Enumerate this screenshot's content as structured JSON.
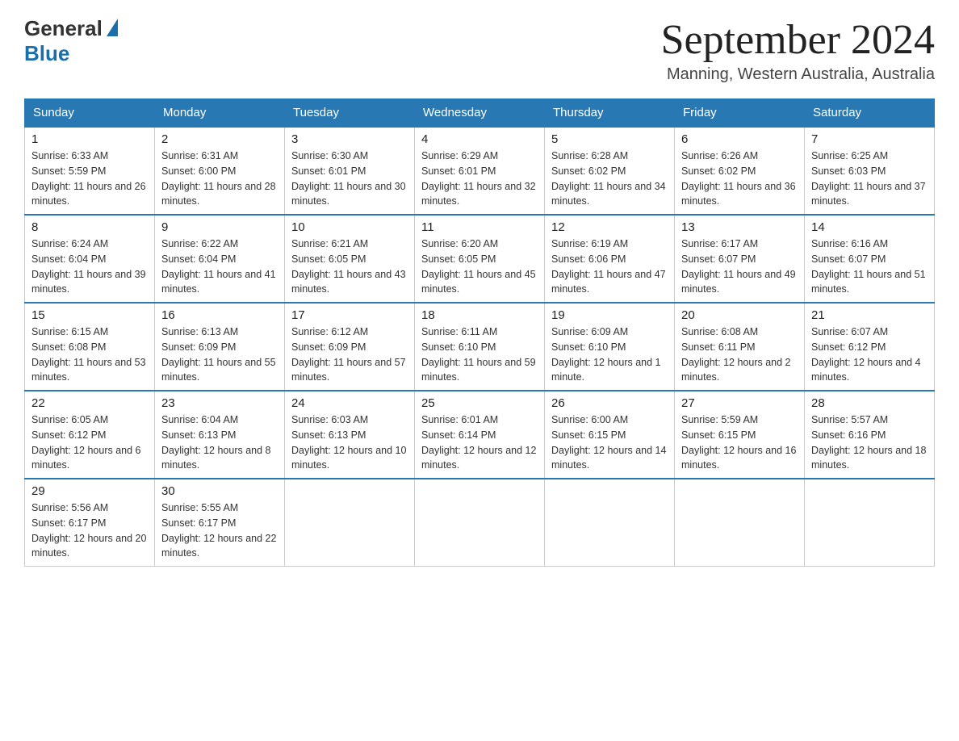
{
  "header": {
    "logo_general": "General",
    "logo_blue": "Blue",
    "month_title": "September 2024",
    "location": "Manning, Western Australia, Australia"
  },
  "weekdays": [
    "Sunday",
    "Monday",
    "Tuesday",
    "Wednesday",
    "Thursday",
    "Friday",
    "Saturday"
  ],
  "weeks": [
    [
      {
        "day": "1",
        "sunrise": "6:33 AM",
        "sunset": "5:59 PM",
        "daylight": "11 hours and 26 minutes."
      },
      {
        "day": "2",
        "sunrise": "6:31 AM",
        "sunset": "6:00 PM",
        "daylight": "11 hours and 28 minutes."
      },
      {
        "day": "3",
        "sunrise": "6:30 AM",
        "sunset": "6:01 PM",
        "daylight": "11 hours and 30 minutes."
      },
      {
        "day": "4",
        "sunrise": "6:29 AM",
        "sunset": "6:01 PM",
        "daylight": "11 hours and 32 minutes."
      },
      {
        "day": "5",
        "sunrise": "6:28 AM",
        "sunset": "6:02 PM",
        "daylight": "11 hours and 34 minutes."
      },
      {
        "day": "6",
        "sunrise": "6:26 AM",
        "sunset": "6:02 PM",
        "daylight": "11 hours and 36 minutes."
      },
      {
        "day": "7",
        "sunrise": "6:25 AM",
        "sunset": "6:03 PM",
        "daylight": "11 hours and 37 minutes."
      }
    ],
    [
      {
        "day": "8",
        "sunrise": "6:24 AM",
        "sunset": "6:04 PM",
        "daylight": "11 hours and 39 minutes."
      },
      {
        "day": "9",
        "sunrise": "6:22 AM",
        "sunset": "6:04 PM",
        "daylight": "11 hours and 41 minutes."
      },
      {
        "day": "10",
        "sunrise": "6:21 AM",
        "sunset": "6:05 PM",
        "daylight": "11 hours and 43 minutes."
      },
      {
        "day": "11",
        "sunrise": "6:20 AM",
        "sunset": "6:05 PM",
        "daylight": "11 hours and 45 minutes."
      },
      {
        "day": "12",
        "sunrise": "6:19 AM",
        "sunset": "6:06 PM",
        "daylight": "11 hours and 47 minutes."
      },
      {
        "day": "13",
        "sunrise": "6:17 AM",
        "sunset": "6:07 PM",
        "daylight": "11 hours and 49 minutes."
      },
      {
        "day": "14",
        "sunrise": "6:16 AM",
        "sunset": "6:07 PM",
        "daylight": "11 hours and 51 minutes."
      }
    ],
    [
      {
        "day": "15",
        "sunrise": "6:15 AM",
        "sunset": "6:08 PM",
        "daylight": "11 hours and 53 minutes."
      },
      {
        "day": "16",
        "sunrise": "6:13 AM",
        "sunset": "6:09 PM",
        "daylight": "11 hours and 55 minutes."
      },
      {
        "day": "17",
        "sunrise": "6:12 AM",
        "sunset": "6:09 PM",
        "daylight": "11 hours and 57 minutes."
      },
      {
        "day": "18",
        "sunrise": "6:11 AM",
        "sunset": "6:10 PM",
        "daylight": "11 hours and 59 minutes."
      },
      {
        "day": "19",
        "sunrise": "6:09 AM",
        "sunset": "6:10 PM",
        "daylight": "12 hours and 1 minute."
      },
      {
        "day": "20",
        "sunrise": "6:08 AM",
        "sunset": "6:11 PM",
        "daylight": "12 hours and 2 minutes."
      },
      {
        "day": "21",
        "sunrise": "6:07 AM",
        "sunset": "6:12 PM",
        "daylight": "12 hours and 4 minutes."
      }
    ],
    [
      {
        "day": "22",
        "sunrise": "6:05 AM",
        "sunset": "6:12 PM",
        "daylight": "12 hours and 6 minutes."
      },
      {
        "day": "23",
        "sunrise": "6:04 AM",
        "sunset": "6:13 PM",
        "daylight": "12 hours and 8 minutes."
      },
      {
        "day": "24",
        "sunrise": "6:03 AM",
        "sunset": "6:13 PM",
        "daylight": "12 hours and 10 minutes."
      },
      {
        "day": "25",
        "sunrise": "6:01 AM",
        "sunset": "6:14 PM",
        "daylight": "12 hours and 12 minutes."
      },
      {
        "day": "26",
        "sunrise": "6:00 AM",
        "sunset": "6:15 PM",
        "daylight": "12 hours and 14 minutes."
      },
      {
        "day": "27",
        "sunrise": "5:59 AM",
        "sunset": "6:15 PM",
        "daylight": "12 hours and 16 minutes."
      },
      {
        "day": "28",
        "sunrise": "5:57 AM",
        "sunset": "6:16 PM",
        "daylight": "12 hours and 18 minutes."
      }
    ],
    [
      {
        "day": "29",
        "sunrise": "5:56 AM",
        "sunset": "6:17 PM",
        "daylight": "12 hours and 20 minutes."
      },
      {
        "day": "30",
        "sunrise": "5:55 AM",
        "sunset": "6:17 PM",
        "daylight": "12 hours and 22 minutes."
      },
      null,
      null,
      null,
      null,
      null
    ]
  ],
  "labels": {
    "sunrise": "Sunrise:",
    "sunset": "Sunset:",
    "daylight": "Daylight:"
  }
}
